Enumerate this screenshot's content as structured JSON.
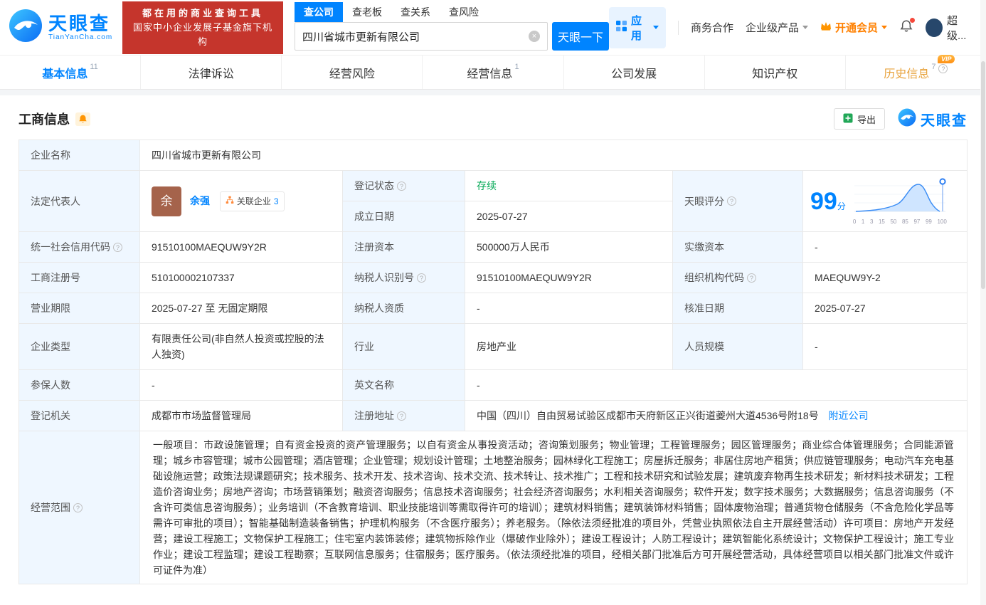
{
  "colors": {
    "accent_blue": "#0084ff",
    "brand_red": "#c5352c",
    "status_green": "#00a854",
    "vip_orange": "#ff8000",
    "history_tab_orange": "#e8a33d"
  },
  "header": {
    "logo": {
      "brand": "天眼查",
      "domain": "TianYanCha.com"
    },
    "promo": {
      "line1": "都在用的商业查询工具",
      "line2": "国家中小企业发展子基金旗下机构"
    },
    "search": {
      "tabs": [
        {
          "label": "查公司"
        },
        {
          "label": "查老板"
        },
        {
          "label": "查关系"
        },
        {
          "label": "查风险"
        }
      ],
      "value": "四川省城市更新有限公司",
      "button": "天眼一下"
    },
    "right": {
      "apps": "应用",
      "cooperation": "商务合作",
      "enterprise": "企业级产品",
      "vip": "开通会员",
      "user": "超级..."
    }
  },
  "tabs": [
    {
      "label": "基本信息",
      "count": "11"
    },
    {
      "label": "法律诉讼"
    },
    {
      "label": "经营风险"
    },
    {
      "label": "经营信息",
      "count": "1"
    },
    {
      "label": "公司发展"
    },
    {
      "label": "知识产权"
    },
    {
      "label": "历史信息",
      "count": "7",
      "vip": "VIP"
    }
  ],
  "section": {
    "title": "工商信息",
    "export": "导出",
    "brand": "天眼查"
  },
  "company": {
    "name_label": "企业名称",
    "name": "四川省城市更新有限公司",
    "legal_label": "法定代表人",
    "legal_avatar": "余",
    "legal_name": "余强",
    "related_badge": "关联企业",
    "related_count": "3",
    "status_label": "登记状态",
    "status": "存续",
    "score_label": "天眼评分",
    "score": "99",
    "score_unit": "分",
    "score_axis": [
      "0",
      "1",
      "3",
      "15",
      "50",
      "85",
      "97",
      "99",
      "100"
    ],
    "established_label": "成立日期",
    "established": "2025-07-27",
    "credit_code_label": "统一社会信用代码",
    "credit_code": "91510100MAEQUW9Y2R",
    "reg_capital_label": "注册资本",
    "reg_capital": "500000万人民币",
    "paid_capital_label": "实缴资本",
    "paid_capital": "-",
    "reg_no_label": "工商注册号",
    "reg_no": "510100002107337",
    "tax_id_label": "纳税人识别号",
    "tax_id": "91510100MAEQUW9Y2R",
    "org_code_label": "组织机构代码",
    "org_code": "MAEQUW9Y-2",
    "term_label": "营业期限",
    "term": "2025-07-27 至 无固定期限",
    "tax_quality_label": "纳税人资质",
    "tax_quality": "-",
    "approved_label": "核准日期",
    "approved": "2025-07-27",
    "type_label": "企业类型",
    "type": "有限责任公司(非自然人投资或控股的法人独资)",
    "industry_label": "行业",
    "industry": "房地产业",
    "staff_label": "人员规模",
    "staff": "-",
    "insured_label": "参保人数",
    "insured": "-",
    "en_name_label": "英文名称",
    "en_name": "-",
    "authority_label": "登记机关",
    "authority": "成都市市场监督管理局",
    "address_label": "注册地址",
    "address": "中国（四川）自由贸易试验区成都市天府新区正兴街道夔州大道4536号附18号",
    "nearby": "附近公司",
    "scope_label": "经营范围",
    "scope": "一般项目：市政设施管理；自有资金投资的资产管理服务；以自有资金从事投资活动；咨询策划服务；物业管理；工程管理服务；园区管理服务；商业综合体管理服务；合同能源管理；城乡市容管理；城市公园管理；酒店管理；企业管理；规划设计管理；土地整治服务；园林绿化工程施工；房屋拆迁服务；非居住房地产租赁；供应链管理服务；电动汽车充电基础设施运营；政策法规课题研究；技术服务、技术开发、技术咨询、技术交流、技术转让、技术推广；工程和技术研究和试验发展；建筑废弃物再生技术研发；新材料技术研发；工程造价咨询业务；房地产咨询；市场营销策划；融资咨询服务；信息技术咨询服务；社会经济咨询服务；水利相关咨询服务；软件开发；数字技术服务；大数据服务；信息咨询服务（不含许可类信息咨询服务）；业务培训（不含教育培训、职业技能培训等需取得许可的培训）；建筑材料销售；建筑装饰材料销售；固体废物治理；普通货物仓储服务（不含危险化学品等需许可审批的项目）；智能基础制造装备销售；护理机构服务（不含医疗服务）；养老服务。（除依法须经批准的项目外，凭营业执照依法自主开展经营活动）许可项目：房地产开发经营；建设工程施工；文物保护工程施工；住宅室内装饰装修；建筑物拆除作业（爆破作业除外）；建设工程设计；人防工程设计；建筑智能化系统设计；文物保护工程设计；施工专业作业；建设工程监理；建设工程勘察；互联网信息服务；住宿服务；医疗服务。（依法须经批准的项目，经相关部门批准后方可开展经营活动，具体经营项目以相关部门批准文件或许可证件为准）"
  }
}
